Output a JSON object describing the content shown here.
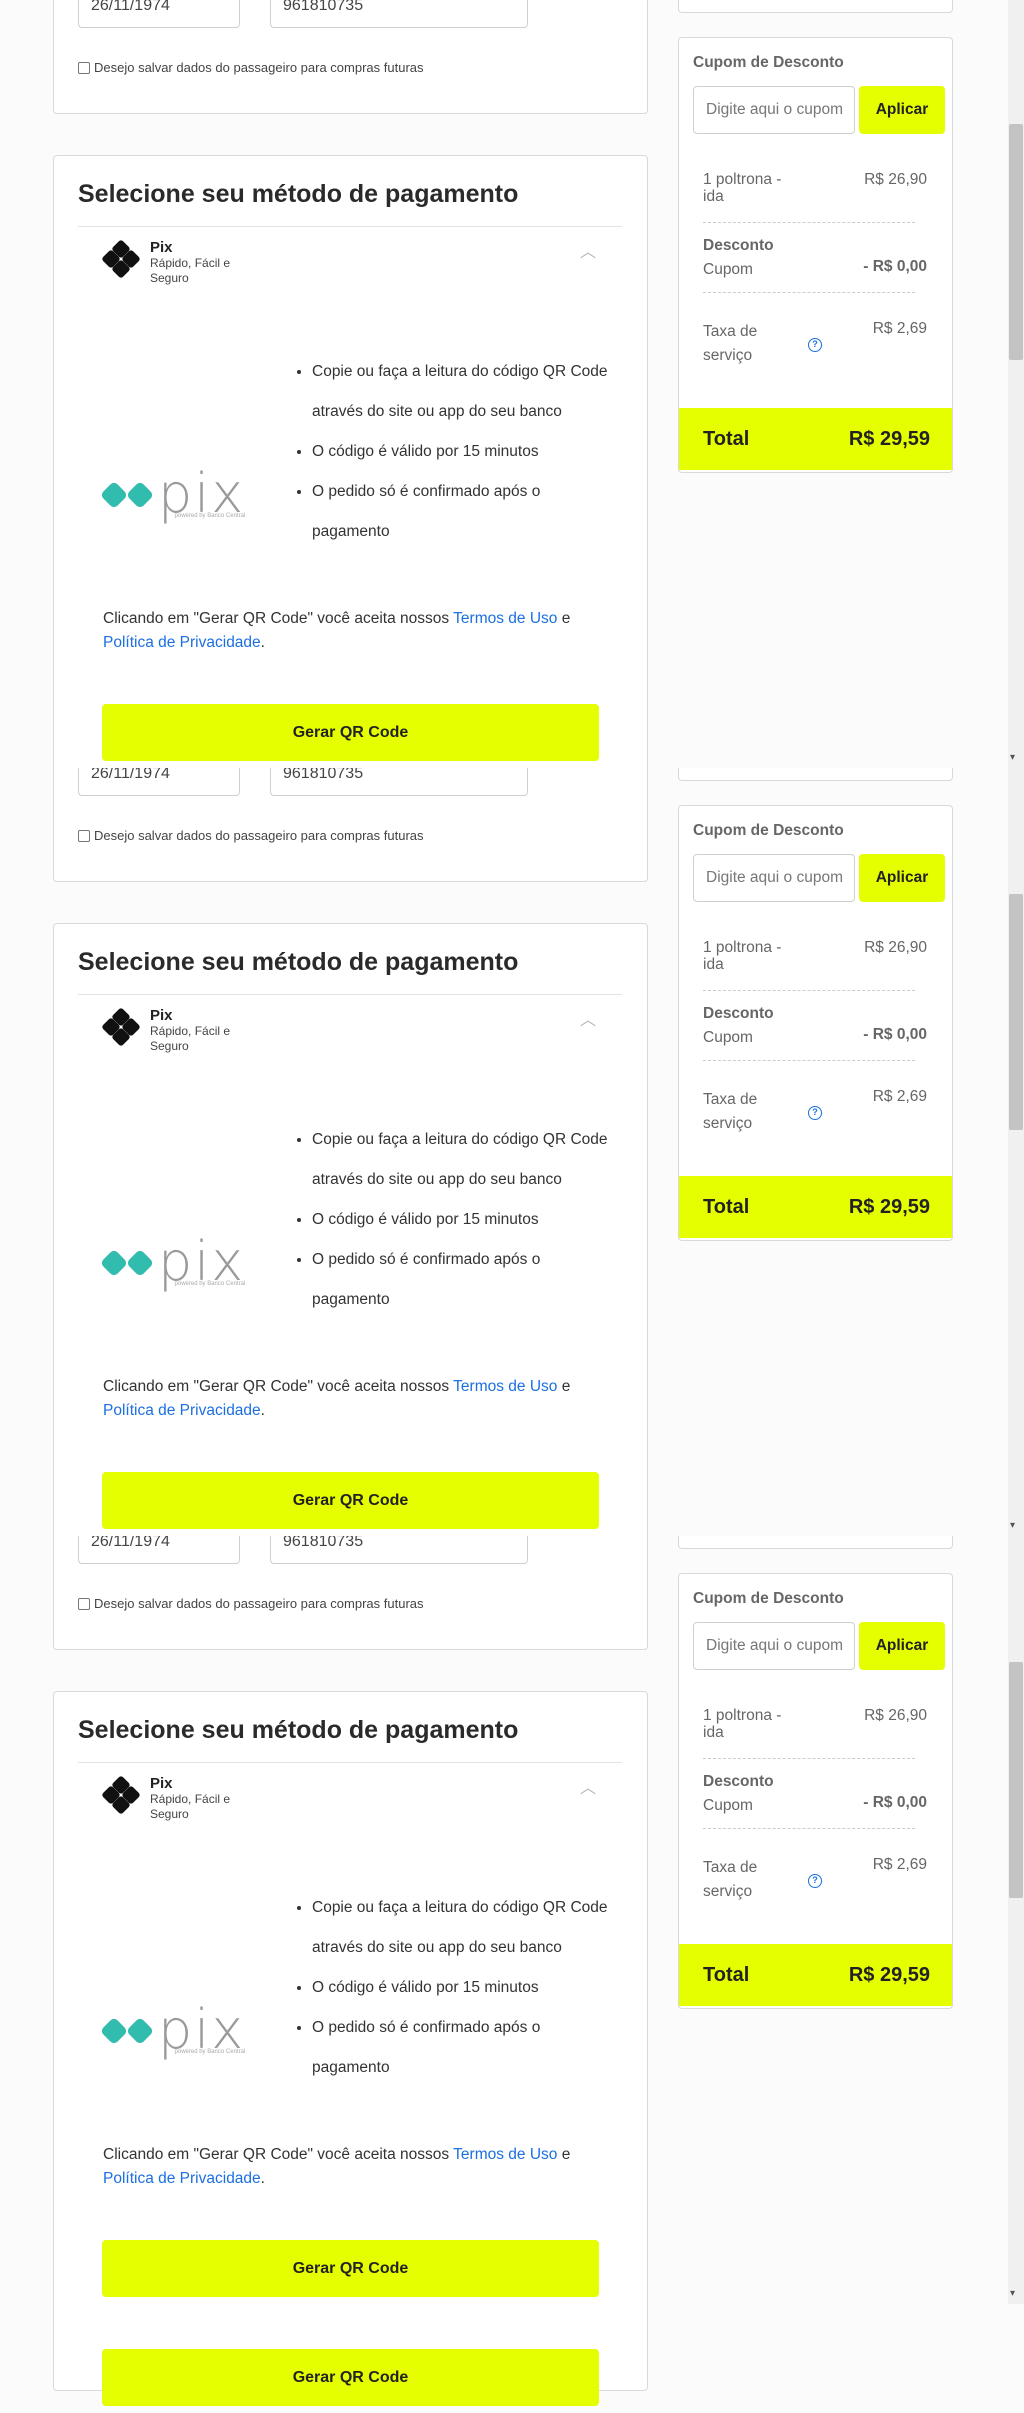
{
  "passenger": {
    "birth_date": "26/11/1974",
    "phone": "961810735",
    "save_data_label": "Desejo salvar dados do passageiro para compras futuras"
  },
  "payment": {
    "title": "Selecione seu método de pagamento",
    "pix_name": "Pix",
    "pix_desc": "Rápido, Fácil e Seguro",
    "pix_logo_word": "pix",
    "pix_logo_sub": "powered by Banco Central",
    "instructions": [
      "Copie ou faça a leitura do código QR Code através do site ou app do seu banco",
      "O código é válido por 15 minutos",
      "O pedido só é confirmado após o pagamento"
    ],
    "terms_prefix": "Clicando em \"Gerar QR Code\" você aceita nossos ",
    "terms_link": "Termos de Uso",
    "terms_and": " e ",
    "privacy_link": "Política de Privacidade",
    "terms_suffix": ".",
    "qr_button": "Gerar QR Code"
  },
  "summary": {
    "coupon_label": "Cupom de Desconto",
    "coupon_placeholder": "Digite aqui o cupom",
    "apply_button": "Aplicar",
    "seat_label": "1 poltrona - ida",
    "seat_price": "R$ 26,90",
    "discount_label": "Desconto",
    "discount_sub": "Cupom",
    "discount_value": "- R$ 0,00",
    "fee_label": "Taxa de serviço",
    "fee_value": "R$ 2,69",
    "total_label": "Total",
    "total_value": "R$ 29,59"
  },
  "colors": {
    "accent": "#e5fe00",
    "link": "#1b6fe0",
    "pix_teal": "#32bcad"
  }
}
